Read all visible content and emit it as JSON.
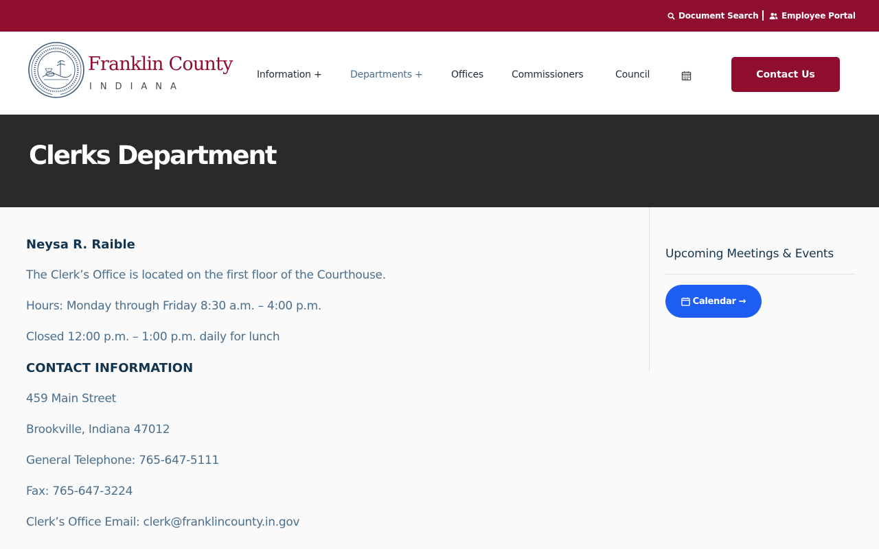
{
  "topbar": {
    "document_search": "Document Search",
    "employee_portal": "Employee Portal"
  },
  "logo": {
    "name": "Franklin County",
    "state": "INDIANA"
  },
  "nav": {
    "information": "Information +",
    "departments": "Departments +",
    "offices": "Offices",
    "commissioners": "Commissioners",
    "council": "Council",
    "calendar_icon": "calendar-icon"
  },
  "header": {
    "contact_button": "Contact Us"
  },
  "hero": {
    "title": "Clerks Department"
  },
  "content": {
    "name": "Neysa R. Raible",
    "location": "The Clerk’s Office is located on the first floor of the Courthouse.",
    "hours": "Hours:  Monday through Friday 8:30 a.m. –  4:00 p.m.",
    "closed": "Closed 12:00 p.m. – 1:00 p.m. daily for lunch",
    "contact_heading": "CONTACT INFORMATION",
    "address_line1": "459 Main Street",
    "address_line2": "Brookville, Indiana 47012",
    "telephone": "General Telephone: 765-647-5111",
    "fax": "Fax: 765-647-3224",
    "email": "Clerk’s Office Email: clerk@franklincounty.in.gov"
  },
  "sidebar": {
    "heading": "Upcoming Meetings & Events",
    "calendar_button": "Calendar →"
  },
  "colors": {
    "brand": "#8f0d2f",
    "hero_bg": "#2a2a2a",
    "link_blue": "#1e5ef5",
    "text": "#4a6f8e",
    "heading": "#12344f"
  }
}
